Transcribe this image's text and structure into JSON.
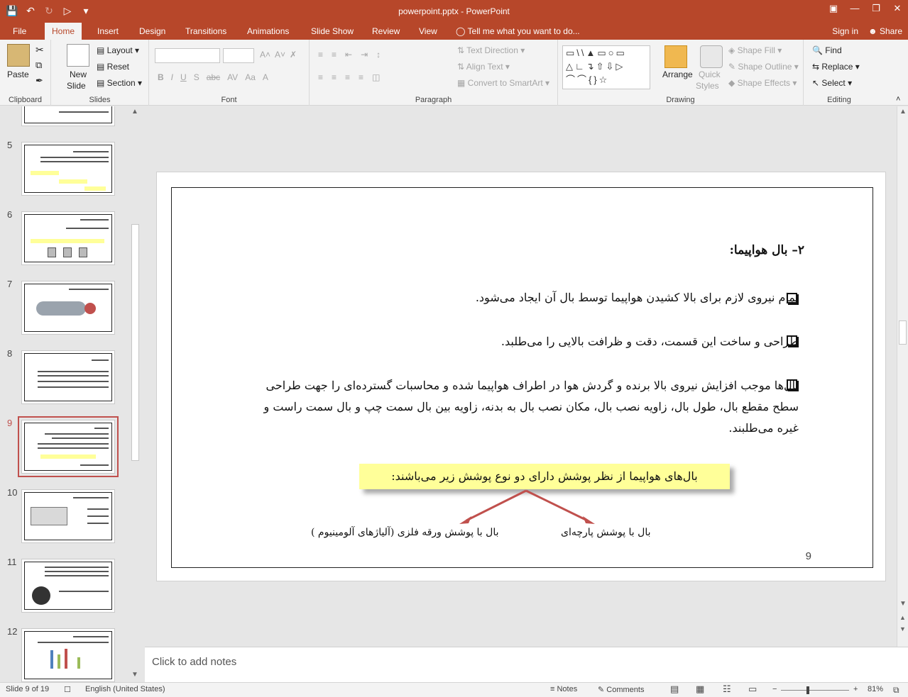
{
  "titlebar": {
    "title": "powerpoint.pptx - PowerPoint",
    "qat": [
      "save-icon",
      "undo-icon",
      "redo-icon",
      "presenter-icon",
      "customize-icon"
    ]
  },
  "tabs": [
    "File",
    "Home",
    "Insert",
    "Design",
    "Transitions",
    "Animations",
    "Slide Show",
    "Review",
    "View"
  ],
  "active_tab": "Home",
  "tellme": "Tell me what you want to do...",
  "signin": "Sign in",
  "share": "Share",
  "ribbon": {
    "clipboard": {
      "label": "Clipboard",
      "paste": "Paste"
    },
    "slides": {
      "label": "Slides",
      "new_slide": "New",
      "new_slide2": "Slide",
      "layout": "Layout",
      "reset": "Reset",
      "section": "Section"
    },
    "font": {
      "label": "Font"
    },
    "paragraph": {
      "label": "Paragraph",
      "text_direction": "Text Direction",
      "align_text": "Align Text",
      "convert": "Convert to SmartArt"
    },
    "drawing": {
      "label": "Drawing",
      "arrange": "Arrange",
      "quick_styles": "Quick",
      "quick_styles2": "Styles",
      "shape_fill": "Shape Fill",
      "shape_outline": "Shape Outline",
      "shape_effects": "Shape Effects"
    },
    "editing": {
      "label": "Editing",
      "find": "Find",
      "replace": "Replace",
      "select": "Select"
    }
  },
  "thumbnails": [
    {
      "num": "5"
    },
    {
      "num": "6"
    },
    {
      "num": "7"
    },
    {
      "num": "8"
    },
    {
      "num": "9"
    },
    {
      "num": "10"
    },
    {
      "num": "11"
    },
    {
      "num": "12"
    }
  ],
  "slide": {
    "title": "۲– بال هواپیما:",
    "bullets": [
      "تمام نیروی لازم برای بالا کشیدن هواپیما توسط بال آن ایجاد می‌شود.",
      "طراحی و ساخت این قسمت، دقت و ظرافت بالایی را می‌طلبد.",
      "بال‌ها موجب افزایش نیروی بالا برنده و گردش هوا در اطراف هواپیما شده و محاسبات گسترده‌ای را جهت طراحی سطح مقطع بال، طول بال، زاویه نصب بال، مکان نصب بال به بدنه، زاویه بین بال سمت چپ و بال سمت راست و غیره  می‌طلبند."
    ],
    "highlight": "بال‌های هواپیما از نظر پوشش دارای دو نوع پوشش زیر می‌باشند:",
    "caption_right": "بال با پوشش پارچه‌ای",
    "caption_left": "بال با پوشش ورقه فلزی (آلیاژهای آلومینیوم )",
    "page_number": "9"
  },
  "notes_placeholder": "Click to add notes",
  "status": {
    "slide": "Slide 9 of 19",
    "language": "English (United States)",
    "notes": "Notes",
    "comments": "Comments",
    "zoom": "81%"
  }
}
